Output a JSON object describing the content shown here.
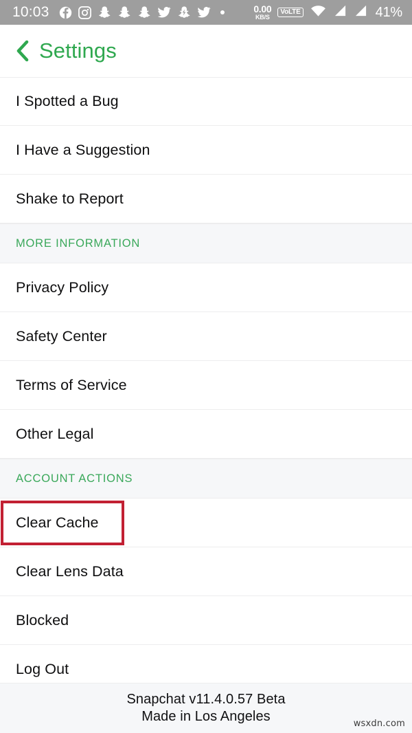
{
  "status_bar": {
    "time": "10:03",
    "network_speed_value": "0.00",
    "network_speed_unit": "KB/S",
    "volte_label": "VoLTE",
    "battery": "41%",
    "notification_icons": [
      "facebook-icon",
      "instagram-icon",
      "snapchat-icon",
      "snapchat-icon",
      "snapchat-icon",
      "twitter-icon",
      "snapchat-bolt-icon",
      "twitter-icon",
      "more-dot-icon"
    ],
    "signal_icons": [
      "wifi-icon",
      "signal-sim1-icon",
      "signal-sim2-icon"
    ],
    "background_color": "#9e9e9e"
  },
  "header": {
    "back_icon": "chevron-left-icon",
    "title": "Settings",
    "accent_color": "#2fa84f"
  },
  "sections": [
    {
      "header": null,
      "items": [
        {
          "label": "I Spotted a Bug",
          "highlighted": false
        },
        {
          "label": "I Have a Suggestion",
          "highlighted": false
        },
        {
          "label": "Shake to Report",
          "highlighted": false
        }
      ]
    },
    {
      "header": "MORE INFORMATION",
      "items": [
        {
          "label": "Privacy Policy",
          "highlighted": false
        },
        {
          "label": "Safety Center",
          "highlighted": false
        },
        {
          "label": "Terms of Service",
          "highlighted": false
        },
        {
          "label": "Other Legal",
          "highlighted": false
        }
      ]
    },
    {
      "header": "ACCOUNT ACTIONS",
      "items": [
        {
          "label": "Clear Cache",
          "highlighted": true
        },
        {
          "label": "Clear Lens Data",
          "highlighted": false
        },
        {
          "label": "Blocked",
          "highlighted": false
        },
        {
          "label": "Log Out",
          "highlighted": false
        }
      ]
    }
  ],
  "footer": {
    "version_line": "Snapchat v11.4.0.57 Beta",
    "location_line": "Made in Los Angeles"
  },
  "watermark": "wsxdn.com",
  "colors": {
    "accent_green": "#2fa84f",
    "section_green": "#3aa85a",
    "highlight_red": "#c22033",
    "band_gray": "#f6f7f9",
    "divider": "#ededee"
  }
}
